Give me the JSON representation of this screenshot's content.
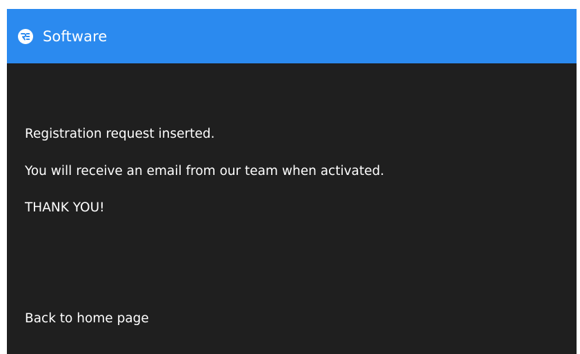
{
  "app": {
    "title": "Software",
    "logo_icon": "app-logo-icon",
    "header_color": "#2b8aef",
    "background_color": "#1f1f1f"
  },
  "message": {
    "line1": "Registration request inserted.",
    "line2": "You will receive an email from our team when activated.",
    "line3": "THANK YOU!"
  },
  "links": {
    "back_home": "Back to home page"
  }
}
